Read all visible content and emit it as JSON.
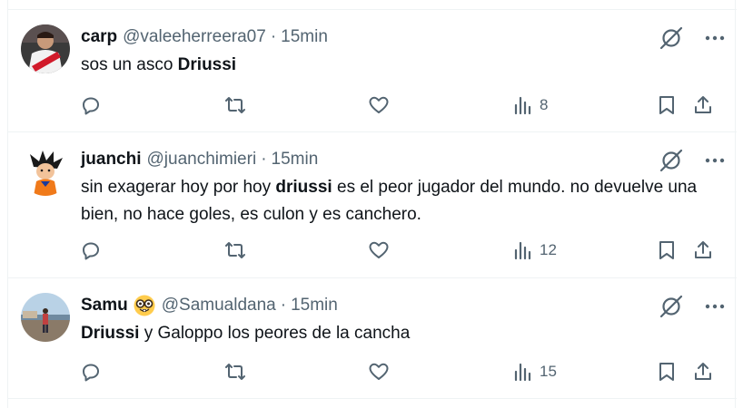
{
  "tweets": [
    {
      "name": "carp",
      "handle": "@valeeherreera07",
      "dot": "·",
      "time": "15min",
      "text_parts": [
        {
          "text": "sos un asco ",
          "bold": false
        },
        {
          "text": "Driussi",
          "bold": true
        }
      ],
      "views": "8",
      "avatar": "avatar-carp",
      "emoji": ""
    },
    {
      "name": "juanchi",
      "handle": "@juanchimieri",
      "dot": "·",
      "time": "15min",
      "text_parts": [
        {
          "text": "sin exagerar hoy por hoy ",
          "bold": false
        },
        {
          "text": "driussi",
          "bold": true
        },
        {
          "text": " es el peor jugador del mundo. no devuelve una bien, no hace goles, es culon y es canchero.",
          "bold": false
        }
      ],
      "views": "12",
      "avatar": "avatar-goku",
      "emoji": ""
    },
    {
      "name": "Samu",
      "handle": "@Samualdana",
      "dot": "·",
      "time": "15min",
      "text_parts": [
        {
          "text": "Driussi",
          "bold": true
        },
        {
          "text": " y Galoppo los peores de la cancha",
          "bold": false
        }
      ],
      "views": "15",
      "avatar": "avatar-beach",
      "emoji": "nerd-face-emoji"
    }
  ],
  "icons": {
    "reply": "reply-icon",
    "retweet": "retweet-icon",
    "like": "like-icon",
    "views": "views-icon",
    "bookmark": "bookmark-icon",
    "share": "share-icon",
    "grok": "grok-icon",
    "more": "more-icon"
  },
  "colors": {
    "icon_gray": "#536471",
    "text": "#0f1419",
    "divider": "#eff3f4"
  }
}
